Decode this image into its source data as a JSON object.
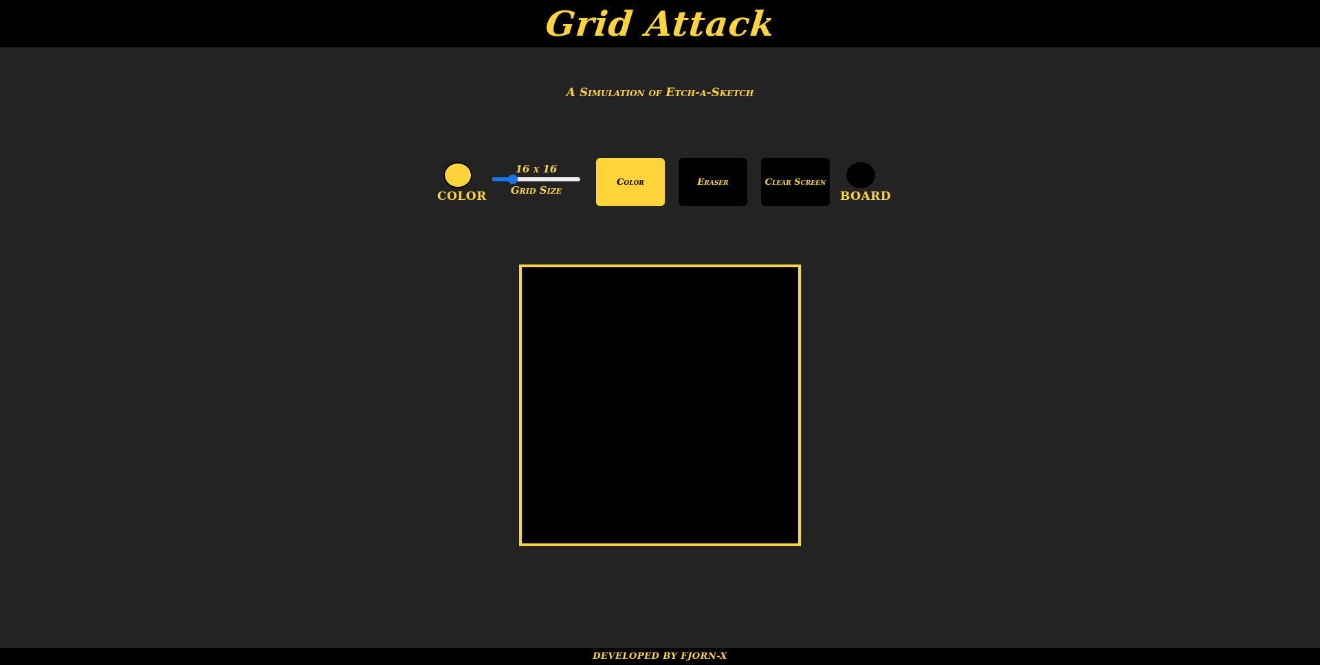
{
  "header": {
    "title": "Grid Attack"
  },
  "subtitle": "A Simulation of Etch-a-Sketch",
  "controls": {
    "color_picker": {
      "label": "COLOR",
      "value": "#FFD43B"
    },
    "grid_size": {
      "value_text": "16 x 16",
      "label": "Grid Size",
      "value": 16,
      "min": 1,
      "max": 64
    },
    "buttons": {
      "color": "Color",
      "eraser": "Eraser",
      "clear": "Clear Screen"
    },
    "board_picker": {
      "label": "BOARD",
      "value": "#000000"
    }
  },
  "board": {
    "background": "#000000",
    "border_color": "#FFD43B"
  },
  "footer": {
    "text": "DEVELOPED BY FJORN-X"
  },
  "colors": {
    "accent": "#FFD43B",
    "page_bg": "#232323",
    "bar_bg": "#000000",
    "slider": "#1A73E8"
  }
}
